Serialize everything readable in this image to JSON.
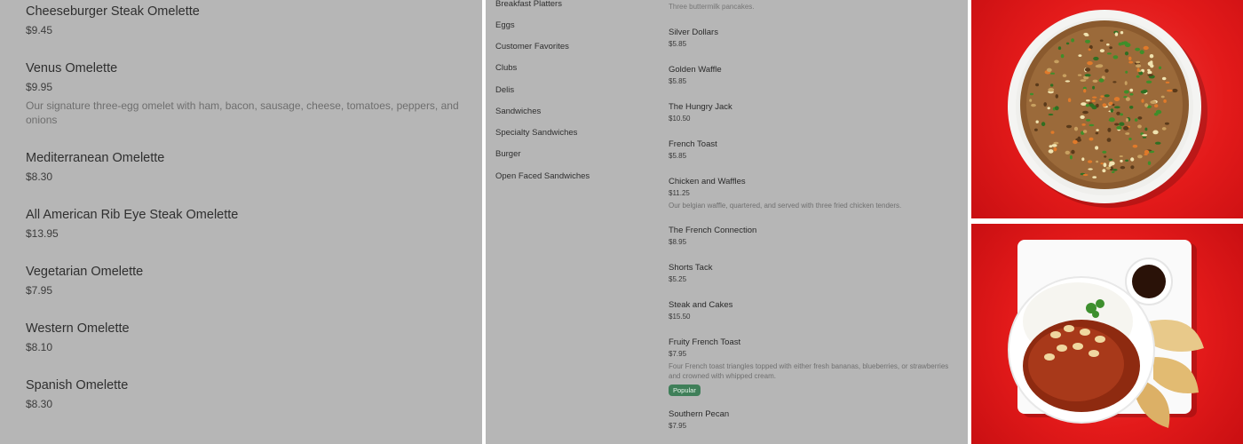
{
  "omelettes": [
    {
      "name": "Cheeseburger Steak Omelette",
      "price": "$9.45"
    },
    {
      "name": "Venus Omelette",
      "price": "$9.95",
      "desc": "Our signature three-egg omelet with ham, bacon, sausage, cheese, tomatoes, peppers, and onions"
    },
    {
      "name": "Mediterranean Omelette",
      "price": "$8.30"
    },
    {
      "name": "All American Rib Eye Steak Omelette",
      "price": "$13.95"
    },
    {
      "name": "Vegetarian Omelette",
      "price": "$7.95"
    },
    {
      "name": "Western Omelette",
      "price": "$8.10"
    },
    {
      "name": "Spanish Omelette",
      "price": "$8.30"
    }
  ],
  "categories": [
    "Breakfast Platters",
    "Eggs",
    "Customer Favorites",
    "Clubs",
    "Delis",
    "Sandwiches",
    "Specialty Sandwiches",
    "Burger",
    "Open Faced Sandwiches"
  ],
  "top_desc": "Three buttermilk pancakes.",
  "menu_items": [
    {
      "name": "Silver Dollars",
      "price": "$5.85"
    },
    {
      "name": "Golden Waffle",
      "price": "$5.85"
    },
    {
      "name": "The Hungry Jack",
      "price": "$10.50"
    },
    {
      "name": "French Toast",
      "price": "$5.85"
    },
    {
      "name": "Chicken and Waffles",
      "price": "$11.25",
      "desc": "Our belgian waffle, quartered, and served with three fried chicken tenders."
    },
    {
      "name": "The French Connection",
      "price": "$8.95"
    },
    {
      "name": "Shorts Tack",
      "price": "$5.25"
    },
    {
      "name": "Steak and Cakes",
      "price": "$15.50"
    },
    {
      "name": "Fruity French Toast",
      "price": "$7.95",
      "desc": "Four French toast triangles topped with either fresh bananas, blueberries, or strawberries and crowned with whipped cream.",
      "badge": "Popular"
    },
    {
      "name": "Southern Pecan",
      "price": "$7.95"
    }
  ],
  "colors": {
    "panel_bg": "#b6b6b6",
    "badge_bg": "#3f7f59",
    "image_bg": "#e31a1a"
  }
}
